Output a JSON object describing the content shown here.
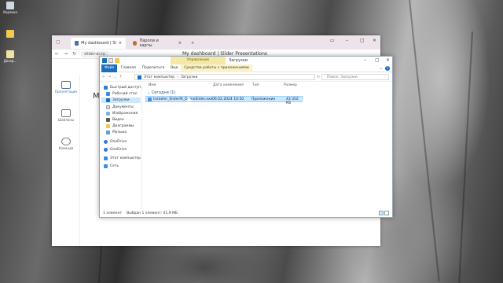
{
  "desktop": {
    "icons": [
      {
        "label": "Корзина",
        "icon": "recycle-bin-icon"
      },
      {
        "label": "",
        "icon": "folder-icon"
      },
      {
        "label": "Дескр...",
        "icon": "document-icon"
      }
    ]
  },
  "browser": {
    "tabs": [
      {
        "label": "My dashboard | Slider Presentations",
        "icon": "slider-favicon"
      },
      {
        "label": "Пароли и карты",
        "icon": "passwords-favicon"
      }
    ],
    "url": "slider-ai.ru",
    "window_title": "My dashboard | Slider Presentations",
    "heading": "M",
    "sidebar": [
      {
        "label": "Презентации",
        "icon": "presentations-icon"
      },
      {
        "label": "Шаблоны",
        "icon": "templates-icon"
      },
      {
        "label": "Команда",
        "icon": "team-icon"
      }
    ]
  },
  "explorer": {
    "context_tab": "Управление",
    "title": "Загрузки",
    "ribbon_tabs": [
      "Файл",
      "Главная",
      "Поделиться",
      "Вид",
      "Средства работы с приложениями"
    ],
    "path": [
      "Этот компьютер",
      "Загрузки"
    ],
    "search_placeholder": "Поиск: Загрузки",
    "nav": [
      {
        "label": "Быстрый доступ",
        "icon": "star-icon"
      },
      {
        "label": "Рабочий стол",
        "icon": "desktop-icon"
      },
      {
        "label": "Загрузки",
        "icon": "download-icon"
      },
      {
        "label": "Документы",
        "icon": "documents-icon"
      },
      {
        "label": "Изображения",
        "icon": "pictures-icon"
      },
      {
        "label": "Видео",
        "icon": "video-icon"
      },
      {
        "label": "Диаграммы",
        "icon": "folder-icon"
      },
      {
        "label": "Музыка",
        "icon": "music-icon"
      },
      {
        "label": "OneDrive",
        "icon": "cloud-icon"
      },
      {
        "label": "OneDrive",
        "icon": "cloud-icon"
      },
      {
        "label": "Этот компьютер",
        "icon": "computer-icon"
      },
      {
        "label": "Сеть",
        "icon": "network-icon"
      }
    ],
    "columns": [
      "Имя",
      "Дата изменения",
      "Тип",
      "Размер"
    ],
    "group": "Сегодня (1)",
    "files": [
      {
        "name": "Installer_Sliderfit_DemoSlider.exe",
        "date": "06.02.2024 10:50",
        "type": "Приложение",
        "size": "43 352 КБ"
      }
    ],
    "status": [
      "1 элемент",
      "Выбран 1 элемент: 41,9 МБ"
    ]
  }
}
